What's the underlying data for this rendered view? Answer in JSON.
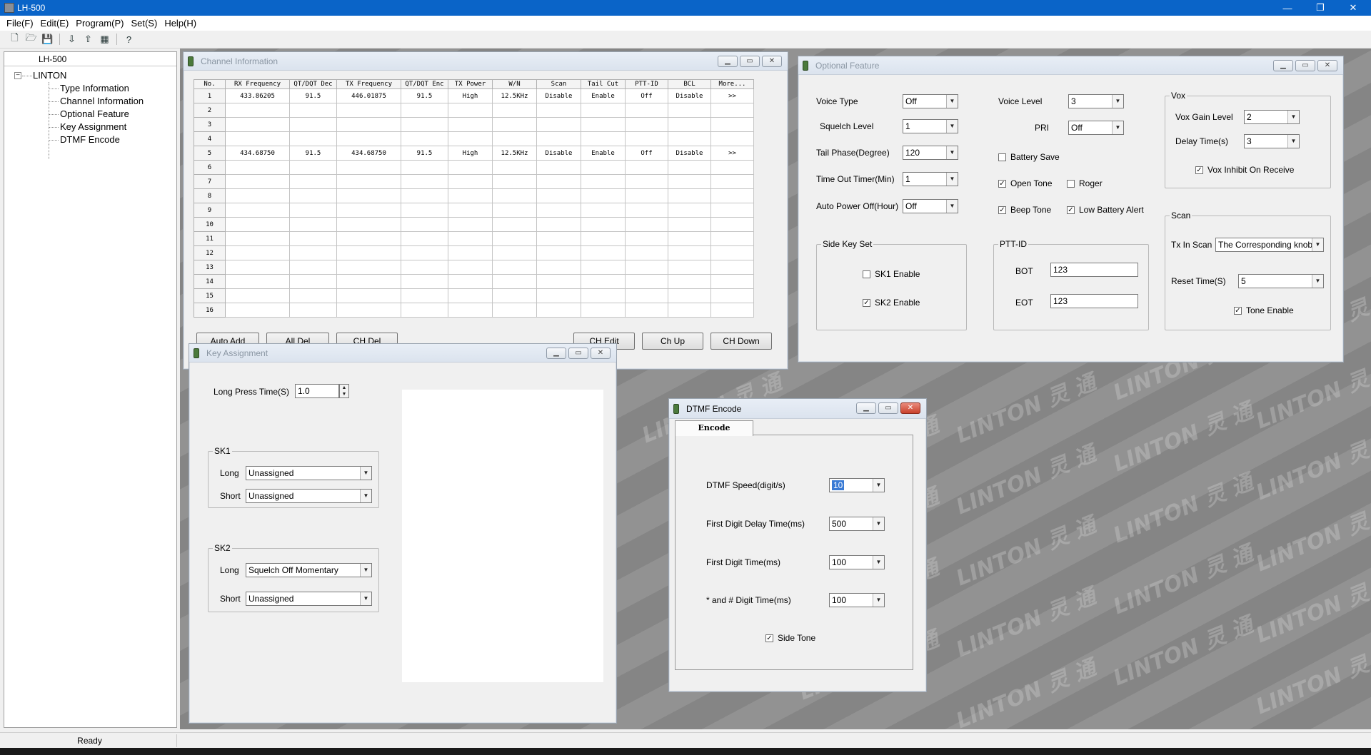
{
  "app": {
    "title": "LH-500",
    "window_controls": [
      "—",
      "❐",
      "✕"
    ]
  },
  "menu": [
    "File(F)",
    "Edit(E)",
    "Program(P)",
    "Set(S)",
    "Help(H)"
  ],
  "toolbar": {
    "icons": [
      "new-icon",
      "open-icon",
      "save-icon",
      "read-radio-icon",
      "write-radio-icon",
      "program-icon",
      "help-icon"
    ]
  },
  "tree": {
    "header": "LH-500",
    "root": "LINTON",
    "items": [
      "Type Information",
      "Channel Information",
      "Optional Feature",
      "Key Assignment",
      "DTMF Encode"
    ]
  },
  "status": {
    "ready": "Ready"
  },
  "watermark": {
    "text": "LINTON 灵 通"
  },
  "windows": {
    "channel": {
      "title": "Channel Information"
    },
    "optional": {
      "title": "Optional Feature"
    },
    "key": {
      "title": "Key Assignment"
    },
    "dtmf": {
      "title": "DTMF Encode"
    }
  },
  "channel": {
    "columns": [
      "No.",
      "RX Frequency",
      "QT/DQT Dec",
      "TX Frequency",
      "QT/DQT Enc",
      "TX Power",
      "W/N",
      "Scan",
      "Tail Cut",
      "PTT-ID",
      "BCL",
      "More..."
    ],
    "rows": [
      [
        "1",
        "433.86205",
        "91.5",
        "446.01875",
        "91.5",
        "High",
        "12.5KHz",
        "Disable",
        "Enable",
        "Off",
        "Disable",
        ">>"
      ],
      [
        "2",
        "",
        "",
        "",
        "",
        "",
        "",
        "",
        "",
        "",
        "",
        ""
      ],
      [
        "3",
        "",
        "",
        "",
        "",
        "",
        "",
        "",
        "",
        "",
        "",
        ""
      ],
      [
        "4",
        "",
        "",
        "",
        "",
        "",
        "",
        "",
        "",
        "",
        "",
        ""
      ],
      [
        "5",
        "434.68750",
        "91.5",
        "434.68750",
        "91.5",
        "High",
        "12.5KHz",
        "Disable",
        "Enable",
        "Off",
        "Disable",
        ">>"
      ],
      [
        "6",
        "",
        "",
        "",
        "",
        "",
        "",
        "",
        "",
        "",
        "",
        ""
      ],
      [
        "7",
        "",
        "",
        "",
        "",
        "",
        "",
        "",
        "",
        "",
        "",
        ""
      ],
      [
        "8",
        "",
        "",
        "",
        "",
        "",
        "",
        "",
        "",
        "",
        "",
        ""
      ],
      [
        "9",
        "",
        "",
        "",
        "",
        "",
        "",
        "",
        "",
        "",
        "",
        ""
      ],
      [
        "10",
        "",
        "",
        "",
        "",
        "",
        "",
        "",
        "",
        "",
        "",
        ""
      ],
      [
        "11",
        "",
        "",
        "",
        "",
        "",
        "",
        "",
        "",
        "",
        "",
        ""
      ],
      [
        "12",
        "",
        "",
        "",
        "",
        "",
        "",
        "",
        "",
        "",
        "",
        ""
      ],
      [
        "13",
        "",
        "",
        "",
        "",
        "",
        "",
        "",
        "",
        "",
        "",
        ""
      ],
      [
        "14",
        "",
        "",
        "",
        "",
        "",
        "",
        "",
        "",
        "",
        "",
        ""
      ],
      [
        "15",
        "",
        "",
        "",
        "",
        "",
        "",
        "",
        "",
        "",
        "",
        ""
      ],
      [
        "16",
        "",
        "",
        "",
        "",
        "",
        "",
        "",
        "",
        "",
        "",
        ""
      ]
    ],
    "buttons": {
      "auto_add": "Auto Add",
      "all_del": "All Del",
      "ch_del": "CH Del",
      "ch_edit": "CH Edit",
      "ch_up": "Ch Up",
      "ch_down": "CH Down"
    }
  },
  "optional": {
    "voice_type": {
      "label": "Voice Type",
      "value": "Off"
    },
    "squelch_level": {
      "label": "Squelch Level",
      "value": "1"
    },
    "tail_phase": {
      "label": "Tail Phase(Degree)",
      "value": "120"
    },
    "time_out_timer": {
      "label": "Time Out Timer(Min)",
      "value": "1"
    },
    "auto_power_off": {
      "label": "Auto Power Off(Hour)",
      "value": "Off"
    },
    "voice_level": {
      "label": "Voice Level",
      "value": "3"
    },
    "pri": {
      "label": "PRI",
      "value": "Off"
    },
    "battery_save": {
      "label": "Battery Save",
      "checked": false
    },
    "open_tone": {
      "label": "Open Tone",
      "checked": true
    },
    "roger": {
      "label": "Roger",
      "checked": false
    },
    "beep_tone": {
      "label": "Beep Tone",
      "checked": true
    },
    "low_battery_alert": {
      "label": "Low Battery Alert",
      "checked": true
    },
    "side_key_set": {
      "title": "Side Key Set",
      "sk1": {
        "label": "SK1 Enable",
        "checked": false
      },
      "sk2": {
        "label": "SK2 Enable",
        "checked": true
      }
    },
    "ptt_id": {
      "title": "PTT-ID",
      "bot_label": "BOT",
      "bot_value": "123",
      "eot_label": "EOT",
      "eot_value": "123"
    },
    "vox": {
      "title": "Vox",
      "gain_label": "Vox Gain Level",
      "gain_value": "2",
      "delay_label": "Delay Time(s)",
      "delay_value": "3",
      "inhibit_label": "Vox Inhibit On Receive",
      "inhibit_checked": true
    },
    "scan": {
      "title": "Scan",
      "tx_in_scan_label": "Tx In Scan",
      "tx_in_scan_value": "The Corresponding knob",
      "reset_label": "Reset Time(S)",
      "reset_value": "5",
      "tone_label": "Tone Enable",
      "tone_checked": true
    }
  },
  "key": {
    "long_press_label": "Long Press Time(S)",
    "long_press_value": "1.0",
    "sk1": {
      "title": "SK1",
      "long_label": "Long",
      "long_value": "Unassigned",
      "short_label": "Short",
      "short_value": "Unassigned"
    },
    "sk2": {
      "title": "SK2",
      "long_label": "Long",
      "long_value": "Squelch Off Momentary",
      "short_label": "Short",
      "short_value": "Unassigned"
    }
  },
  "dtmf": {
    "tab": "Encode",
    "speed": {
      "label": "DTMF Speed(digit/s)",
      "value": "10"
    },
    "first_delay": {
      "label": "First Digit Delay Time(ms)",
      "value": "500"
    },
    "first_digit": {
      "label": "First Digit Time(ms)",
      "value": "100"
    },
    "star_hash": {
      "label": "* and # Digit Time(ms)",
      "value": "100"
    },
    "side_tone": {
      "label": "Side Tone",
      "checked": true
    }
  }
}
